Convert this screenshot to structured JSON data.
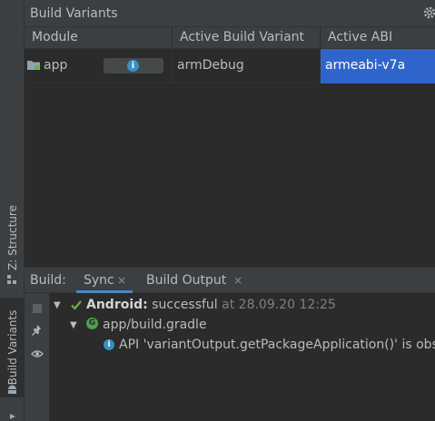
{
  "panel": {
    "title": "Build Variants",
    "columns": [
      "Module",
      "Active Build Variant",
      "Active ABI"
    ],
    "rows": [
      {
        "module": "app",
        "variant": "armDebug",
        "abi": "armeabi-v7a",
        "info_icon": "info-icon"
      }
    ],
    "selected_color": "#2f65ca"
  },
  "stripe": {
    "structure_label": "Z: Structure",
    "variants_label": "Build Variants"
  },
  "build_window": {
    "label": "Build:",
    "tabs": [
      {
        "label": "Sync",
        "close": "×"
      },
      {
        "label": "Build Output",
        "close": "×"
      }
    ],
    "tree": {
      "root_name": "Android:",
      "root_status": "successful",
      "root_time": "at 28.09.20 12:25",
      "child": "app/build.gradle",
      "message": "API 'variantOutput.getPackageApplication()' is obs"
    }
  }
}
